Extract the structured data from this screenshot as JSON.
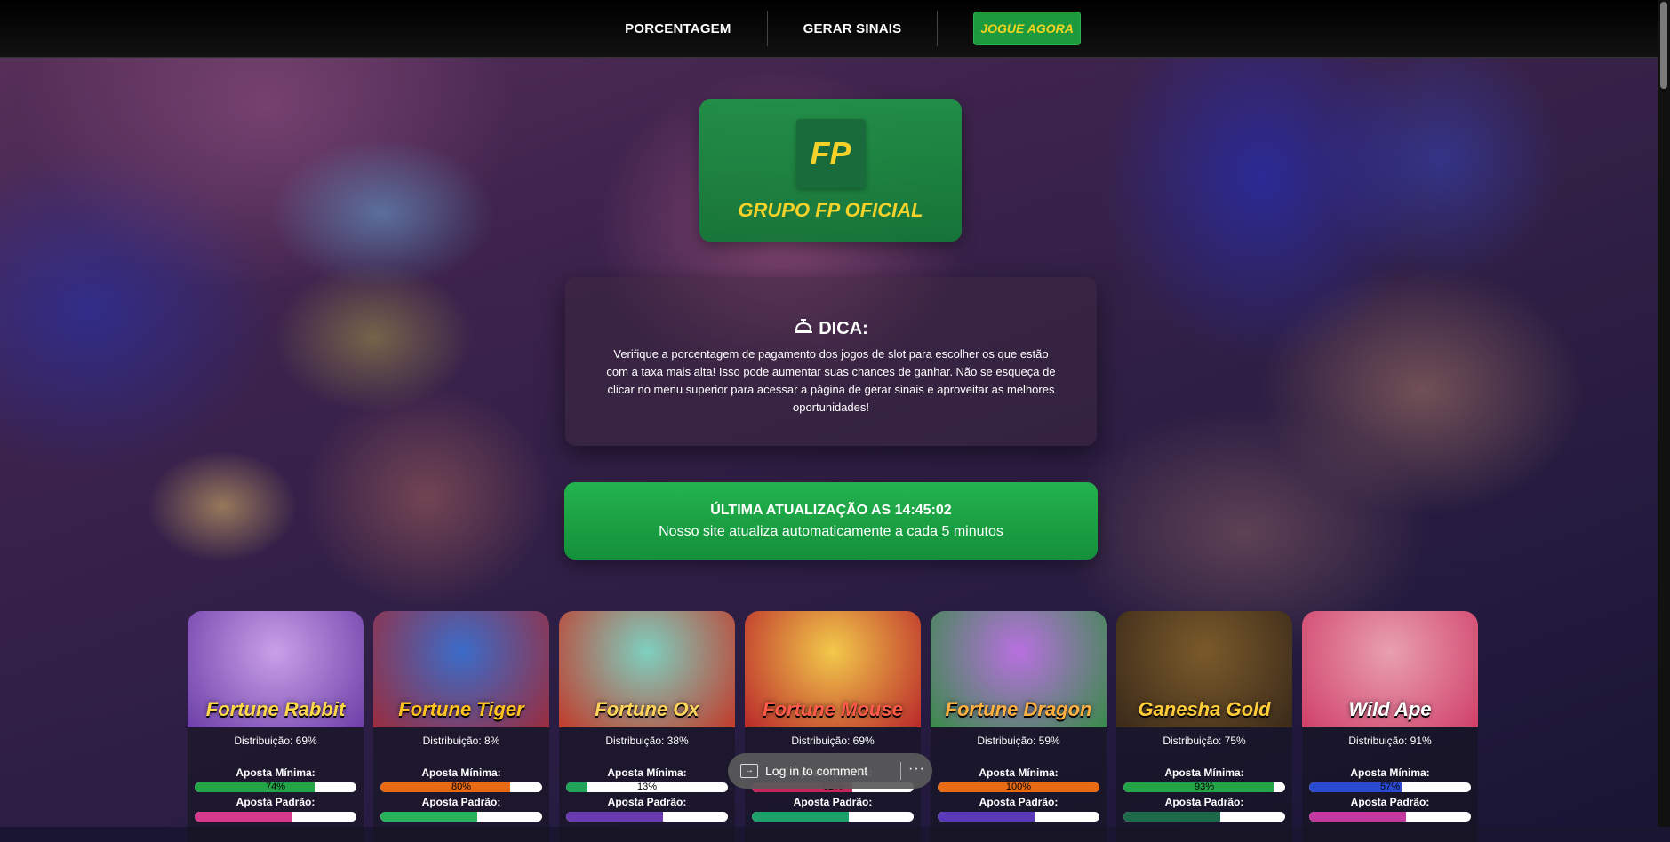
{
  "nav": {
    "items": [
      {
        "label": "PORCENTAGEM"
      },
      {
        "label": "GERAR SINAIS"
      }
    ],
    "cta": "JOGUE AGORA"
  },
  "logo": {
    "mark": "FP",
    "title": "GRUPO FP OFICIAL"
  },
  "tip": {
    "icon": "bell-icon",
    "title": "DICA:",
    "text": "Verifique a porcentagem de pagamento dos jogos de slot para escolher os que estão com a taxa mais alta! Isso pode aumentar suas chances de ganhar. Não se esqueça de clicar no menu superior para acessar a página de gerar sinais e aproveitar as melhores oportunidades!"
  },
  "update": {
    "title": "ÚLTIMA ATUALIZAÇÃO AS 14:45:02",
    "subtitle": "Nosso site atualiza automaticamente a cada 5 minutos"
  },
  "labels": {
    "min_bet": "Aposta Mínima:",
    "std_bet": "Aposta Padrão:"
  },
  "games": [
    {
      "logo": "Fortune Rabbit",
      "distribution": "Distribuição: 69%",
      "min_pct": 74,
      "min_label": "74%",
      "min_color": "#22a447",
      "std_color": "#d63a8c",
      "bg1": "#c9a0e8",
      "bg2": "#6d3fa8",
      "text_color": "#ffd84a"
    },
    {
      "logo": "Fortune Tiger",
      "distribution": "Distribuição: 8%",
      "min_pct": 80,
      "min_label": "80%",
      "min_color": "#e86a12",
      "std_color": "#2ab05a",
      "bg1": "#3b6cc9",
      "bg2": "#9a2c3e",
      "text_color": "#ffc21e"
    },
    {
      "logo": "Fortune Ox",
      "distribution": "Distribuição: 38%",
      "min_pct": 13,
      "min_label": "13%",
      "min_color": "#22a35a",
      "std_color": "#6a3ab0",
      "bg1": "#7ed0c0",
      "bg2": "#c23a2a",
      "text_color": "#ffd45a"
    },
    {
      "logo": "Fortune Mouse",
      "distribution": "Distribuição: 69%",
      "min_pct": 62,
      "min_label": "62%",
      "min_color": "#c4265a",
      "std_color": "#1ea06a",
      "bg1": "#f2c94a",
      "bg2": "#b9282a",
      "text_color": "#ff5a4a"
    },
    {
      "logo": "Fortune Dragon",
      "distribution": "Distribuição: 59%",
      "min_pct": 100,
      "min_label": "100%",
      "min_color": "#e86a12",
      "std_color": "#5a3ab8",
      "bg1": "#b870e0",
      "bg2": "#3a8a4a",
      "text_color": "#ffb040"
    },
    {
      "logo": "Ganesha Gold",
      "distribution": "Distribuição: 75%",
      "min_pct": 93,
      "min_label": "93%",
      "min_color": "#22a447",
      "std_color": "#1c6a4a",
      "bg1": "#7a5a2a",
      "bg2": "#3a2a1a",
      "text_color": "#ffcc3a"
    },
    {
      "logo": "Wild Ape",
      "distribution": "Distribuição: 91%",
      "min_pct": 57,
      "min_label": "57%",
      "min_color": "#2a4ad0",
      "std_color": "#c23aa0",
      "bg1": "#e8a0b0",
      "bg2": "#d0406a",
      "text_color": "#ffffff"
    }
  ],
  "comment": {
    "label": "Log in to comment",
    "more": "···"
  }
}
